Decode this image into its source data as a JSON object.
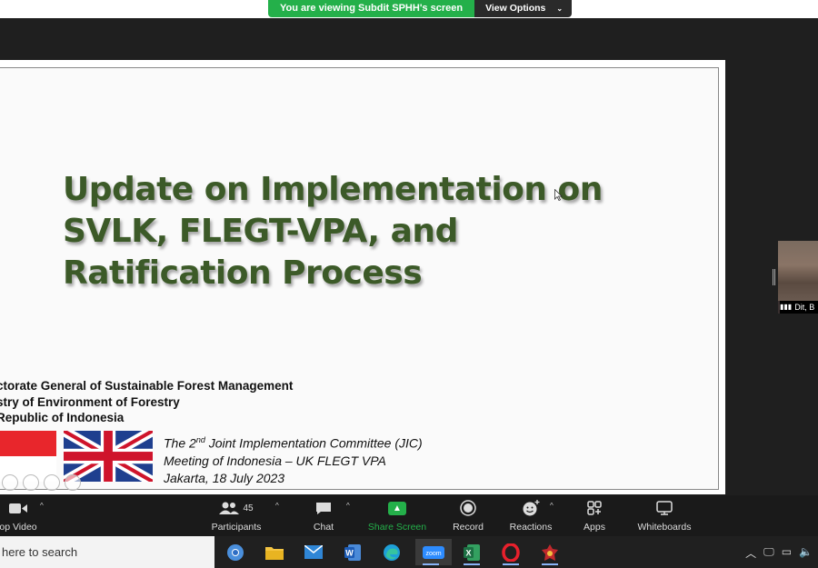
{
  "banner": {
    "viewing_text": "You are viewing Subdit SPHH's screen",
    "view_options_label": "View Options",
    "chevron": "⌄"
  },
  "slide": {
    "title_line1": "Update on Implementation on",
    "title_line2": "SVLK, FLEGT-VPA, and",
    "title_line3": "Ratification Process",
    "org_line1": "ctorate General of Sustainable Forest Management",
    "org_line2": "stry of Environment of Forestry",
    "org_line3": "Republic of Indonesia",
    "jic_prefix": "The 2",
    "jic_sup": "nd",
    "jic_suffix": "  Joint Implementation Committee (JIC)",
    "jic_line2": "Meeting of Indonesia – UK FLEGT VPA",
    "jic_line3": "Jakarta, 18 July 2023",
    "title_color": "#3c5a28"
  },
  "thumbnail": {
    "name": "Dit, B",
    "signal_icon": "signal-bars-icon"
  },
  "toolbar": {
    "video_label": "op Video",
    "participants_label": "Participants",
    "participants_count": "45",
    "chat_label": "Chat",
    "share_label": "Share Screen",
    "record_label": "Record",
    "reactions_label": "Reactions",
    "apps_label": "Apps",
    "whiteboards_label": "Whiteboards",
    "accent": "#24b04a"
  },
  "taskbar": {
    "search_text": "here to search",
    "apps": [
      "chrome-icon",
      "file-explorer-icon",
      "mail-icon",
      "word-icon",
      "edge-icon",
      "zoom-icon",
      "excel-icon",
      "opera-icon",
      "game-icon"
    ],
    "zoom_label": "zoom"
  }
}
